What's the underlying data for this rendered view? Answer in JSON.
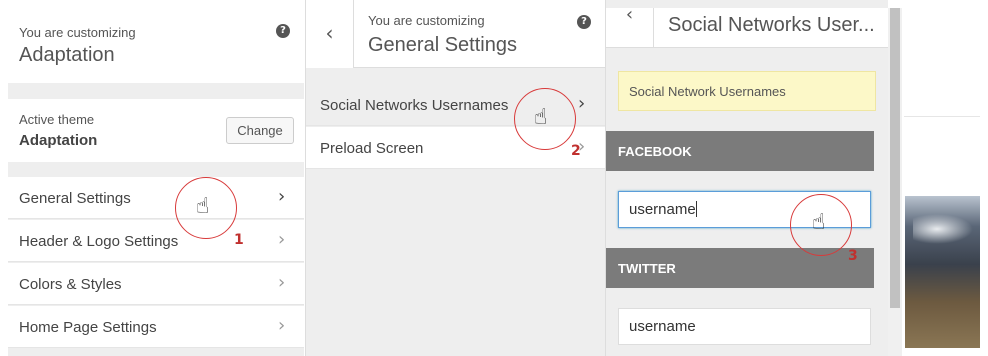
{
  "panel1": {
    "customizing_label": "You are customizing",
    "site_name": "Adaptation",
    "active_theme_label": "Active theme",
    "active_theme_name": "Adaptation",
    "change_button": "Change",
    "menu": [
      {
        "label": "General Settings"
      },
      {
        "label": "Header & Logo Settings"
      },
      {
        "label": "Colors & Styles"
      },
      {
        "label": "Home Page Settings"
      }
    ]
  },
  "panel2": {
    "customizing_label": "You are customizing",
    "title": "General Settings",
    "items": [
      {
        "label": "Social Networks Usernames"
      },
      {
        "label": "Preload Screen"
      }
    ]
  },
  "panel3": {
    "title": "Social Networks User...",
    "notice": "Social Network Usernames",
    "facebook_heading": "FACEBOOK",
    "facebook_value": "username",
    "twitter_heading": "TWITTER",
    "twitter_value": "username"
  },
  "annotations": {
    "step1": "1",
    "step2": "2",
    "step3": "3"
  },
  "icons": {
    "help": "?",
    "back": "‹",
    "chevron": "›",
    "pointer": "☝"
  },
  "colors": {
    "section_header_bg": "#7b7b7b",
    "notice_bg": "#fcf8c8",
    "annotation_red": "#c0302e",
    "focus_border": "#5b9dd9"
  }
}
